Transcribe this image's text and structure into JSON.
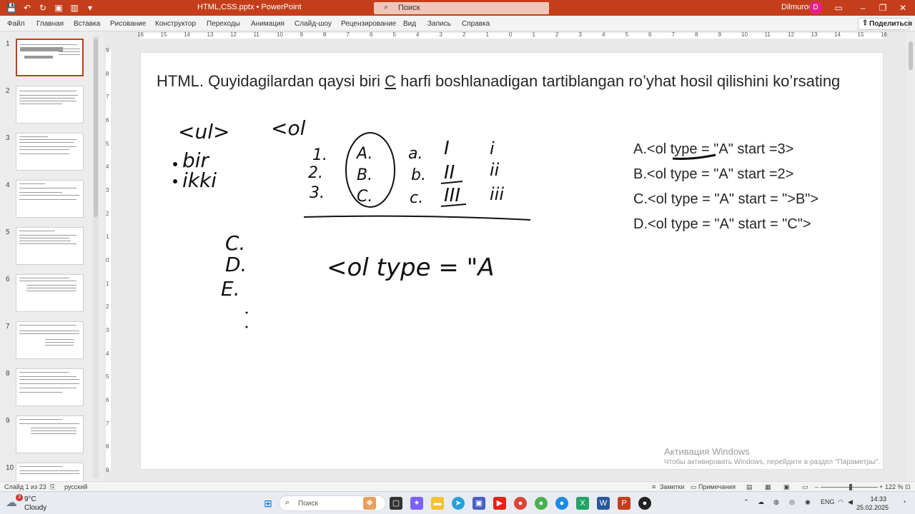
{
  "window": {
    "title": "HTML,CSS.pptx • PowerPoint",
    "search_label": "Поиск",
    "user_name": "Dilmurod",
    "user_initial": "D"
  },
  "ribbon": {
    "tabs": [
      "Файл",
      "Главная",
      "Вставка",
      "Рисование",
      "Конструктор",
      "Переходы",
      "Анимация",
      "Слайд-шоу",
      "Рецензирование",
      "Вид",
      "Запись",
      "Справка"
    ],
    "share_label": "Поделиться"
  },
  "thumbnails": {
    "numbers": [
      "1",
      "2",
      "3",
      "4",
      "5",
      "6",
      "7",
      "8",
      "9",
      "10"
    ],
    "active": 1
  },
  "ruler": {
    "labels": [
      "16",
      "15",
      "14",
      "13",
      "12",
      "11",
      "10",
      "9",
      "8",
      "7",
      "6",
      "5",
      "4",
      "3",
      "2",
      "1",
      "0",
      "1",
      "2",
      "3",
      "4",
      "5",
      "6",
      "7",
      "8",
      "9",
      "10",
      "11",
      "12",
      "13",
      "14",
      "15",
      "16"
    ],
    "left_labels": [
      "9",
      "8",
      "7",
      "6",
      "5",
      "4",
      "3",
      "2",
      "1",
      "0",
      "1",
      "2",
      "3",
      "4",
      "5",
      "6",
      "7",
      "8",
      "9"
    ]
  },
  "slide": {
    "title_part1": "HTML. Quyidagilardan qaysi biri ",
    "title_letter": "C",
    "title_part2": " harfi boshlanadigan tartiblangan ro’yhat hosil qilishini ko’rsating",
    "answers": [
      "A.<ol type = \"A\" start =3>",
      "B.<ol type = \"A\" start =2>",
      "C.<ol type = \"A\" start = \">B\">",
      "D.<ol type = \"A\" start = \"C\">"
    ],
    "ink": {
      "ul_tag": "<ul>",
      "ol_tag": "<ol",
      "bullet1": "bir",
      "bullet2": "ikki",
      "num_col": [
        "1.",
        "2.",
        "3."
      ],
      "upper_col": [
        "A.",
        "B.",
        "C."
      ],
      "lower_col": [
        "a.",
        "b.",
        "c."
      ],
      "roman_col": [
        "I",
        "II",
        "III"
      ],
      "small_roman_col": [
        "i",
        "ii",
        "iii"
      ],
      "cde_col": [
        "C.",
        "D.",
        "E."
      ],
      "ol_type": "<ol type = \"A"
    },
    "activation_title": "Активация Windows",
    "activation_text": "Чтобы активировать Windows, перейдите в раздел \"Параметры\"."
  },
  "statusbar": {
    "slide_info": "Слайд 1 из 23",
    "language": "русский",
    "notes": "Заметки",
    "comments": "Примечания",
    "zoom": "122 %"
  },
  "taskbar": {
    "temperature": "9°C",
    "condition": "Cloudy",
    "weather_badge": "3",
    "search_label": "Поиск",
    "lang": "ENG",
    "time": "14:33",
    "date": "25.02.2025"
  },
  "colors": {
    "accent": "#c43e1c",
    "avatar": "#e91e8c"
  }
}
